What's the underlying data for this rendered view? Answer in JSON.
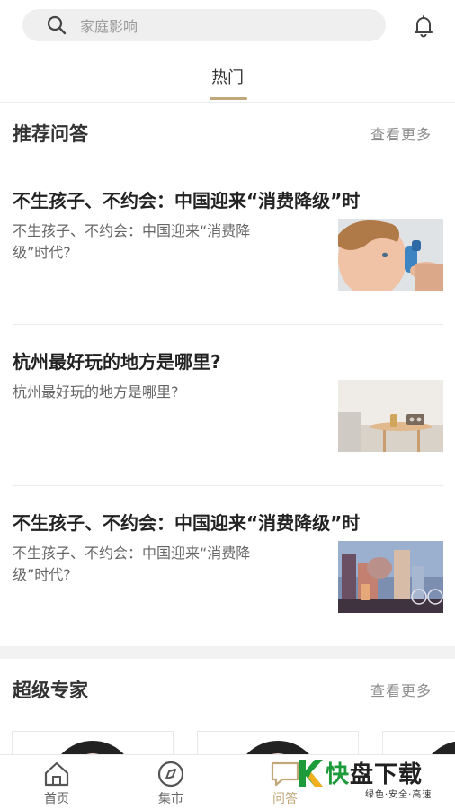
{
  "search": {
    "placeholder": "家庭影响"
  },
  "tabs": [
    {
      "label": "热门",
      "active": true
    }
  ],
  "recommended": {
    "title": "推荐问答",
    "more": "查看更多",
    "items": [
      {
        "title": "不生孩子、不约会：中国迎来“消费降级”时",
        "desc": "不生孩子、不约会：中国迎来“消费降级”时代?",
        "thumb": "child-inhaler-photo"
      },
      {
        "title": "杭州最好玩的地方是哪里?",
        "desc": "杭州最好玩的地方是哪里?",
        "thumb": "living-room-photo"
      },
      {
        "title": "不生孩子、不约会：中国迎来“消费降级”时",
        "desc": "不生孩子、不约会：中国迎来“消费降级”时代?",
        "thumb": "city-illustration"
      }
    ]
  },
  "experts": {
    "title": "超级专家",
    "more": "查看更多"
  },
  "bottom_nav": [
    {
      "label": "首页",
      "icon": "home-icon"
    },
    {
      "label": "集市",
      "icon": "compass-icon"
    },
    {
      "label": "问答",
      "icon": "chat-bubble-icon",
      "active": true
    }
  ],
  "watermark": {
    "main_green": "快",
    "main_dark": "盘下载",
    "sub": "绿色·安全·高速"
  },
  "colors": {
    "accent": "#c1a779",
    "watermark_green": "#1d9b3a"
  }
}
